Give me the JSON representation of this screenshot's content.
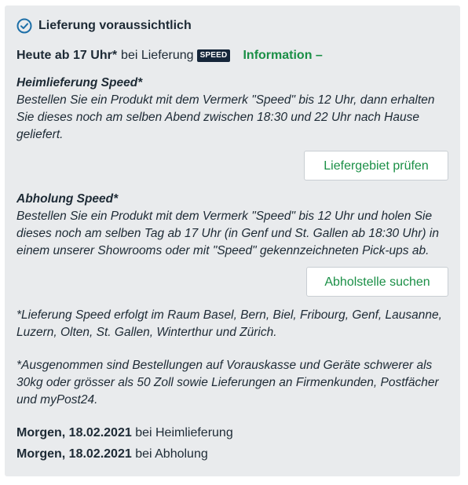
{
  "header": {
    "title": "Lieferung voraussichtlich",
    "icon": "check-circle-icon"
  },
  "delivery": {
    "time": "Heute ab 17 Uhr*",
    "method": "bei Lieferung",
    "badge": "SPEED",
    "info_link": "Information –"
  },
  "home_delivery": {
    "heading": "Heimlieferung Speed*",
    "text": "Bestellen Sie ein Produkt mit dem Vermerk \"Speed\" bis 12 Uhr, dann erhalten Sie dieses noch am selben Abend zwischen 18:30 und 22 Uhr nach Hause geliefert.",
    "button": "Liefergebiet prüfen"
  },
  "pickup": {
    "heading": "Abholung Speed*",
    "text": "Bestellen Sie ein Produkt mit dem Vermerk \"Speed\" bis 12 Uhr und holen Sie dieses noch am selben Tag ab 17 Uhr (in Genf und St. Gallen ab 18:30 Uhr) in einem unserer Showrooms oder mit \"Speed\" gekennzeichneten Pick-ups ab.",
    "button": "Abholstelle suchen"
  },
  "footnotes": [
    "*Lieferung Speed erfolgt im Raum Basel, Bern, Biel, Fribourg, Genf, Lausanne, Luzern, Olten, St. Gallen, Winterthur und Zürich.",
    "*Ausgenommen sind Bestellungen auf Vorauskasse und Geräte schwerer als 30kg oder grösser als 50 Zoll sowie Lieferungen an Firmenkunden, Postfächer und myPost24."
  ],
  "dates": [
    {
      "date": "Morgen, 18.02.2021",
      "method": "bei Heimlieferung"
    },
    {
      "date": "Morgen, 18.02.2021",
      "method": "bei Abholung"
    }
  ],
  "colors": {
    "accent": "#1a8f46",
    "text": "#1d2a35",
    "panel": "#e9ebed",
    "badge": "#16263a",
    "icon": "#1d6fa8"
  }
}
